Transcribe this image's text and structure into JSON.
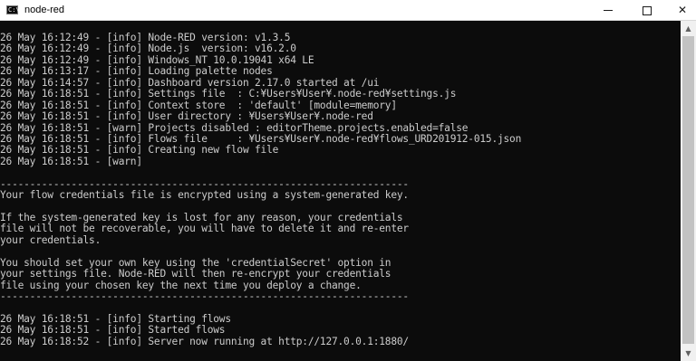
{
  "window": {
    "title": "node-red",
    "icon": "console-app-icon",
    "icon_text": "C:\\"
  },
  "controls": {
    "minimize_icon": "minimize-icon",
    "maximize_icon": "maximize-icon",
    "close_glyph": "✕"
  },
  "console": {
    "background": "#0c0c0c",
    "text_color": "#cccccc",
    "lines": [
      "26 May 16:12:49 - [info] Node-RED version: v1.3.5",
      "26 May 16:12:49 - [info] Node.js  version: v16.2.0",
      "26 May 16:12:49 - [info] Windows_NT 10.0.19041 x64 LE",
      "26 May 16:13:17 - [info] Loading palette nodes",
      "26 May 16:14:57 - [info] Dashboard version 2.17.0 started at /ui",
      "26 May 16:18:51 - [info] Settings file  : C:¥Users¥User¥.node-red¥settings.js",
      "26 May 16:18:51 - [info] Context store  : 'default' [module=memory]",
      "26 May 16:18:51 - [info] User directory : ¥Users¥User¥.node-red",
      "26 May 16:18:51 - [warn] Projects disabled : editorTheme.projects.enabled=false",
      "26 May 16:18:51 - [info] Flows file     : ¥Users¥User¥.node-red¥flows_URD201912-015.json",
      "26 May 16:18:51 - [info] Creating new flow file",
      "26 May 16:18:51 - [warn]",
      "",
      "---------------------------------------------------------------------",
      "Your flow credentials file is encrypted using a system-generated key.",
      "",
      "If the system-generated key is lost for any reason, your credentials",
      "file will not be recoverable, you will have to delete it and re-enter",
      "your credentials.",
      "",
      "You should set your own key using the 'credentialSecret' option in",
      "your settings file. Node-RED will then re-encrypt your credentials",
      "file using your chosen key the next time you deploy a change.",
      "---------------------------------------------------------------------",
      "",
      "26 May 16:18:51 - [info] Starting flows",
      "26 May 16:18:51 - [info] Started flows",
      "26 May 16:18:52 - [info] Server now running at http://127.0.0.1:1880/"
    ]
  },
  "scrollbar": {
    "up_glyph": "▲",
    "down_glyph": "▼",
    "position_fraction": 1.0
  }
}
